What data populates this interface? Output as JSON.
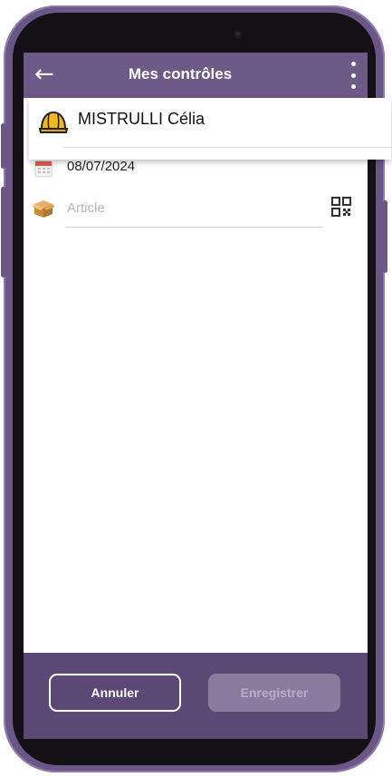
{
  "appbar": {
    "title": "Mes contrôles",
    "back_icon": "←"
  },
  "user_dropdown": {
    "selected": "MISTRULLI Célia",
    "icon": "helmet-icon"
  },
  "date_field": {
    "value": "08/07/2024",
    "icon": "calendar-icon"
  },
  "article_field": {
    "placeholder": "Article",
    "icon": "box-icon",
    "scan_icon": "qr-code-icon"
  },
  "actions": {
    "cancel_label": "Annuler",
    "save_label": "Enregistrer"
  },
  "colors": {
    "primary": "#6e5a86",
    "bottom_bar": "#5b4874",
    "disabled_button": "#8c7b9f"
  }
}
